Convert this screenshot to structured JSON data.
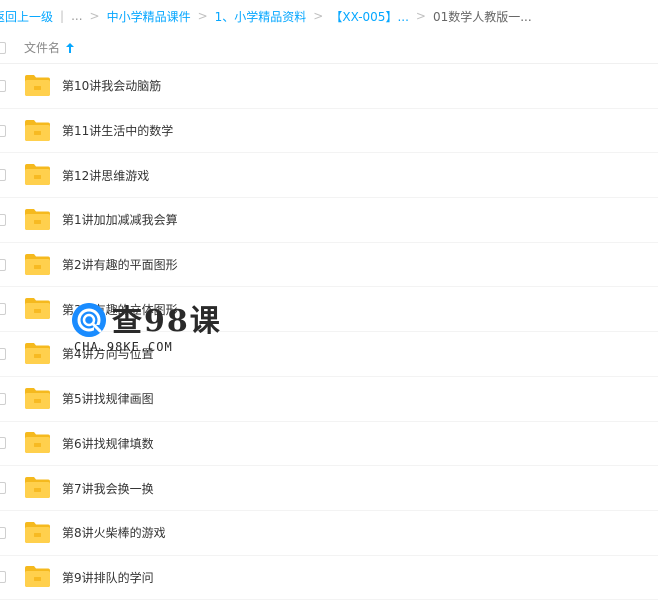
{
  "breadcrumb": {
    "back_label": "返回上一级",
    "first_ellipsis": "...",
    "items": [
      "中小学精品课件",
      "1、小学精品资料",
      "【XX-005】..."
    ],
    "current": "01数学人教版一..."
  },
  "header": {
    "column_name": "文件名"
  },
  "files": [
    {
      "name": "第10讲我会动脑筋"
    },
    {
      "name": "第11讲生活中的数学"
    },
    {
      "name": "第12讲思维游戏"
    },
    {
      "name": "第1讲加加减减我会算"
    },
    {
      "name": "第2讲有趣的平面图形"
    },
    {
      "name": "第3讲有趣的立体图形"
    },
    {
      "name": "第4讲方向与位置"
    },
    {
      "name": "第5讲找规律画图"
    },
    {
      "name": "第6讲找规律填数"
    },
    {
      "name": "第7讲我会换一换"
    },
    {
      "name": "第8讲火柴棒的游戏"
    },
    {
      "name": "第9讲排队的学问"
    }
  ],
  "watermark": {
    "title": "查98课",
    "subtitle": "CHA.98KE.COM"
  },
  "colors": {
    "link": "#06a7ff",
    "folder": "#ffd04d",
    "folder_tab": "#f5b91e"
  }
}
